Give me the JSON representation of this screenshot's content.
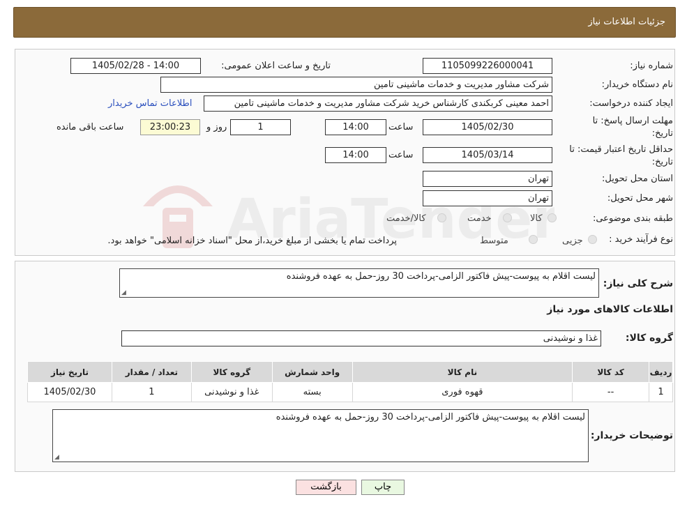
{
  "header": {
    "title": "جزئیات اطلاعات نیاز"
  },
  "form": {
    "need_number_label": "شماره نیاز:",
    "need_number": "1105099226000041",
    "announce_label": "تاریخ و ساعت اعلان عمومی:",
    "announce_value": "1405/02/28 - 14:00",
    "buyer_org_label": "نام دستگاه خریدار:",
    "buyer_org": "شرکت مشاور مدیریت و خدمات ماشینی تامین",
    "requester_label": "ایجاد کننده درخواست:",
    "requester": "احمد معینی کربکندی کارشناس خرید شرکت مشاور مدیریت و خدمات ماشینی تامین",
    "buyer_contact_link": "اطلاعات تماس خریدار",
    "deadline_label": "مهلت ارسال پاسخ: تا تاریخ:",
    "deadline_date": "1405/02/30",
    "hour_label": "ساعت",
    "deadline_time": "14:00",
    "days_value": "1",
    "days_label": "روز و",
    "remaining_time": "23:00:23",
    "remaining_label": "ساعت باقی مانده",
    "validity_label": "حداقل تاریخ اعتبار قیمت: تا تاریخ:",
    "validity_date": "1405/03/14",
    "validity_time": "14:00",
    "province_label": "استان محل تحویل:",
    "province": "تهران",
    "city_label": "شهر محل تحویل:",
    "city": "تهران",
    "category_label": "طبقه بندی موضوعی:",
    "category_options": [
      "کالا",
      "خدمت",
      "کالا/خدمت"
    ],
    "process_label": "نوع فرآیند خرید :",
    "process_options": [
      "جزیی",
      "متوسط"
    ],
    "process_note": "پرداخت تمام یا بخشی از مبلغ خرید،از محل \"اسناد خزانه اسلامی\" خواهد بود."
  },
  "details": {
    "description_label": "شرح کلی نیاز:",
    "description": "لیست اقلام به پیوست-پیش فاکتور الزامی-پرداخت 30 روز-حمل به عهده فروشنده",
    "goods_info_title": "اطلاعات کالاهای مورد نیاز",
    "goods_group_label": "گروه کالا:",
    "goods_group": "غذا و نوشیدنی",
    "table": {
      "headers": [
        "ردیف",
        "کد کالا",
        "نام کالا",
        "واحد شمارش",
        "گروه کالا",
        "تعداد / مقدار",
        "تاریخ نیاز"
      ],
      "rows": [
        [
          "1",
          "--",
          "قهوه فوری",
          "بسته",
          "غذا و نوشیدنی",
          "1",
          "1405/02/30"
        ]
      ]
    },
    "buyer_notes_label": "توضیحات خریدار:",
    "buyer_notes": "لیست اقلام به پیوست-پیش فاکتور الزامی-پرداخت 30 روز-حمل به عهده فروشنده"
  },
  "buttons": {
    "print": "چاپ",
    "back": "بازگشت"
  },
  "watermark": {
    "text": "AriaTender.neT"
  },
  "colors": {
    "header_bg": "#8b6a3a",
    "link": "#2a4fbd",
    "table_header_bg": "#d9d9d9",
    "print_bg": "#e9f8e1",
    "back_bg": "#fbe1e1",
    "remaining_bg": "#fcfbd4"
  }
}
